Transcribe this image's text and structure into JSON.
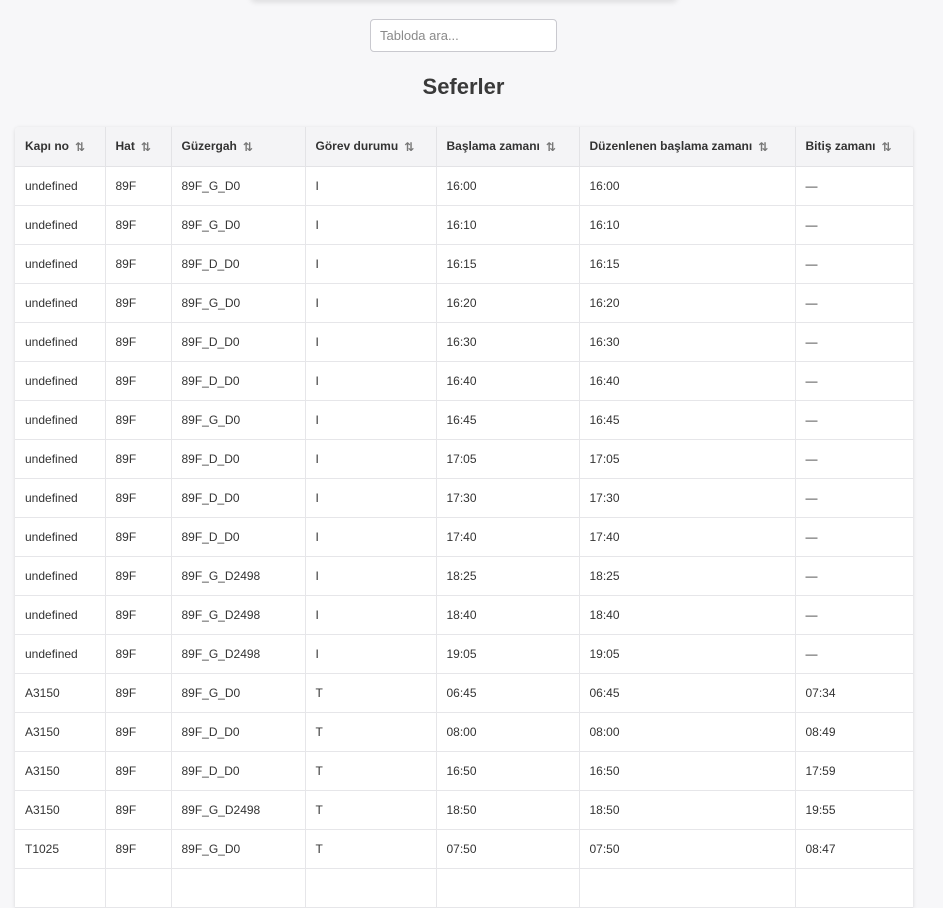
{
  "search": {
    "placeholder": "Tabloda ara..."
  },
  "page_title": "Seferler",
  "table": {
    "columns": [
      {
        "label": "Kapı no",
        "sort_icon": "sort-ascending-icon",
        "sort_glyph": "⇅"
      },
      {
        "label": "Hat",
        "sort_icon": "sort-icon",
        "sort_glyph": "⇅"
      },
      {
        "label": "Güzergah",
        "sort_icon": "sort-icon",
        "sort_glyph": "⇅"
      },
      {
        "label": "Görev durumu",
        "sort_icon": "sort-icon",
        "sort_glyph": "⇅"
      },
      {
        "label": "Başlama zamanı",
        "sort_icon": "sort-icon",
        "sort_glyph": "⇅"
      },
      {
        "label": "Düzenlenen başlama zamanı",
        "sort_icon": "sort-icon",
        "sort_glyph": "⇅"
      },
      {
        "label": "Bitiş zamanı",
        "sort_icon": "sort-icon",
        "sort_glyph": "⇅"
      }
    ],
    "rows": [
      [
        "undefined",
        "89F",
        "89F_G_D0",
        "I",
        "16:00",
        "16:00",
        "—"
      ],
      [
        "undefined",
        "89F",
        "89F_G_D0",
        "I",
        "16:10",
        "16:10",
        "—"
      ],
      [
        "undefined",
        "89F",
        "89F_D_D0",
        "I",
        "16:15",
        "16:15",
        "—"
      ],
      [
        "undefined",
        "89F",
        "89F_G_D0",
        "I",
        "16:20",
        "16:20",
        "—"
      ],
      [
        "undefined",
        "89F",
        "89F_D_D0",
        "I",
        "16:30",
        "16:30",
        "—"
      ],
      [
        "undefined",
        "89F",
        "89F_D_D0",
        "I",
        "16:40",
        "16:40",
        "—"
      ],
      [
        "undefined",
        "89F",
        "89F_G_D0",
        "I",
        "16:45",
        "16:45",
        "—"
      ],
      [
        "undefined",
        "89F",
        "89F_D_D0",
        "I",
        "17:05",
        "17:05",
        "—"
      ],
      [
        "undefined",
        "89F",
        "89F_D_D0",
        "I",
        "17:30",
        "17:30",
        "—"
      ],
      [
        "undefined",
        "89F",
        "89F_D_D0",
        "I",
        "17:40",
        "17:40",
        "—"
      ],
      [
        "undefined",
        "89F",
        "89F_G_D2498",
        "I",
        "18:25",
        "18:25",
        "—"
      ],
      [
        "undefined",
        "89F",
        "89F_G_D2498",
        "I",
        "18:40",
        "18:40",
        "—"
      ],
      [
        "undefined",
        "89F",
        "89F_G_D2498",
        "I",
        "19:05",
        "19:05",
        "—"
      ],
      [
        "A3150",
        "89F",
        "89F_G_D0",
        "T",
        "06:45",
        "06:45",
        "07:34"
      ],
      [
        "A3150",
        "89F",
        "89F_D_D0",
        "T",
        "08:00",
        "08:00",
        "08:49"
      ],
      [
        "A3150",
        "89F",
        "89F_D_D0",
        "T",
        "16:50",
        "16:50",
        "17:59"
      ],
      [
        "A3150",
        "89F",
        "89F_G_D2498",
        "T",
        "18:50",
        "18:50",
        "19:55"
      ],
      [
        "T1025",
        "89F",
        "89F_G_D0",
        "T",
        "07:50",
        "07:50",
        "08:47"
      ],
      [
        "",
        "",
        "",
        "",
        "",
        "",
        ""
      ]
    ]
  }
}
